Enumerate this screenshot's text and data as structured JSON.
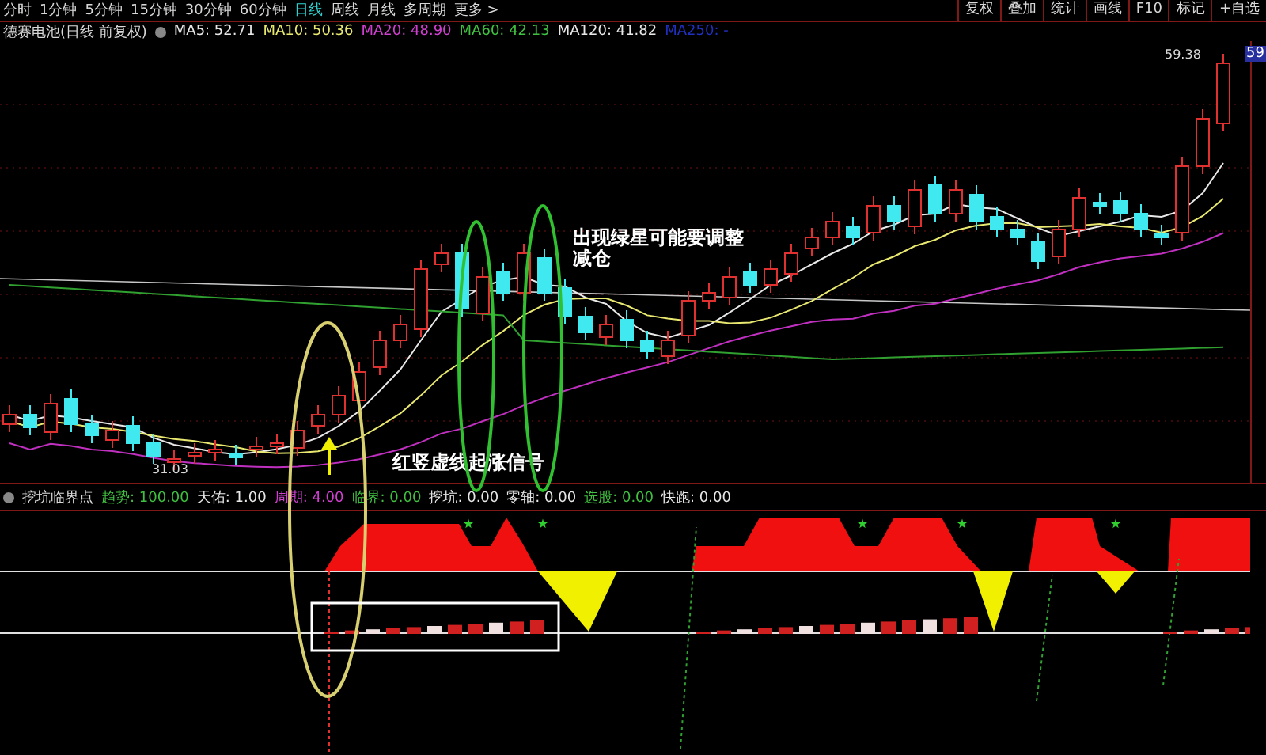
{
  "toolbar": {
    "periods": [
      {
        "label": "分时",
        "selected": false
      },
      {
        "label": "1分钟",
        "selected": false
      },
      {
        "label": "5分钟",
        "selected": false
      },
      {
        "label": "15分钟",
        "selected": false
      },
      {
        "label": "30分钟",
        "selected": false
      },
      {
        "label": "60分钟",
        "selected": false
      },
      {
        "label": "日线",
        "selected": true
      },
      {
        "label": "周线",
        "selected": false
      },
      {
        "label": "月线",
        "selected": false
      },
      {
        "label": "多周期",
        "selected": false
      },
      {
        "label": "更多 >",
        "selected": false
      }
    ],
    "buttons": [
      "复权",
      "叠加",
      "统计",
      "画线",
      "F10",
      "标记",
      "+自选"
    ]
  },
  "price_panel": {
    "title": "德赛电池(日线 前复权)",
    "indicators": [
      {
        "label": "MA5: 52.71",
        "color": "#e8e8e8"
      },
      {
        "label": "MA10: 50.36",
        "color": "#e8e870"
      },
      {
        "label": "MA20: 48.90",
        "color": "#d040d0"
      },
      {
        "label": "MA60: 42.13",
        "color": "#40c040"
      },
      {
        "label": "MA120: 41.82",
        "color": "#e8e8e8"
      },
      {
        "label": "MA250: -",
        "color": "#2030c0"
      }
    ],
    "high_label": "59.38",
    "low_label": "31.03",
    "price_tag": "59",
    "annotations": [
      "出现绿星可能要调整减仓",
      "红竖虚线起涨信号"
    ]
  },
  "indicator_panel": {
    "title": "挖坑临界点",
    "values": [
      {
        "label": "趋势: 100.00",
        "color": "#40c040"
      },
      {
        "label": "天佑: 1.00",
        "color": "#e8e8e8"
      },
      {
        "label": "周期: 4.00",
        "color": "#d040d0"
      },
      {
        "label": "临界: 0.00",
        "color": "#40c040"
      },
      {
        "label": "挖坑: 0.00",
        "color": "#e8e8e8"
      },
      {
        "label": "零轴: 0.00",
        "color": "#e8e8e8"
      },
      {
        "label": "选股: 0.00",
        "color": "#40c040"
      },
      {
        "label": "快跑: 0.00",
        "color": "#e8e8e8"
      }
    ]
  }
}
